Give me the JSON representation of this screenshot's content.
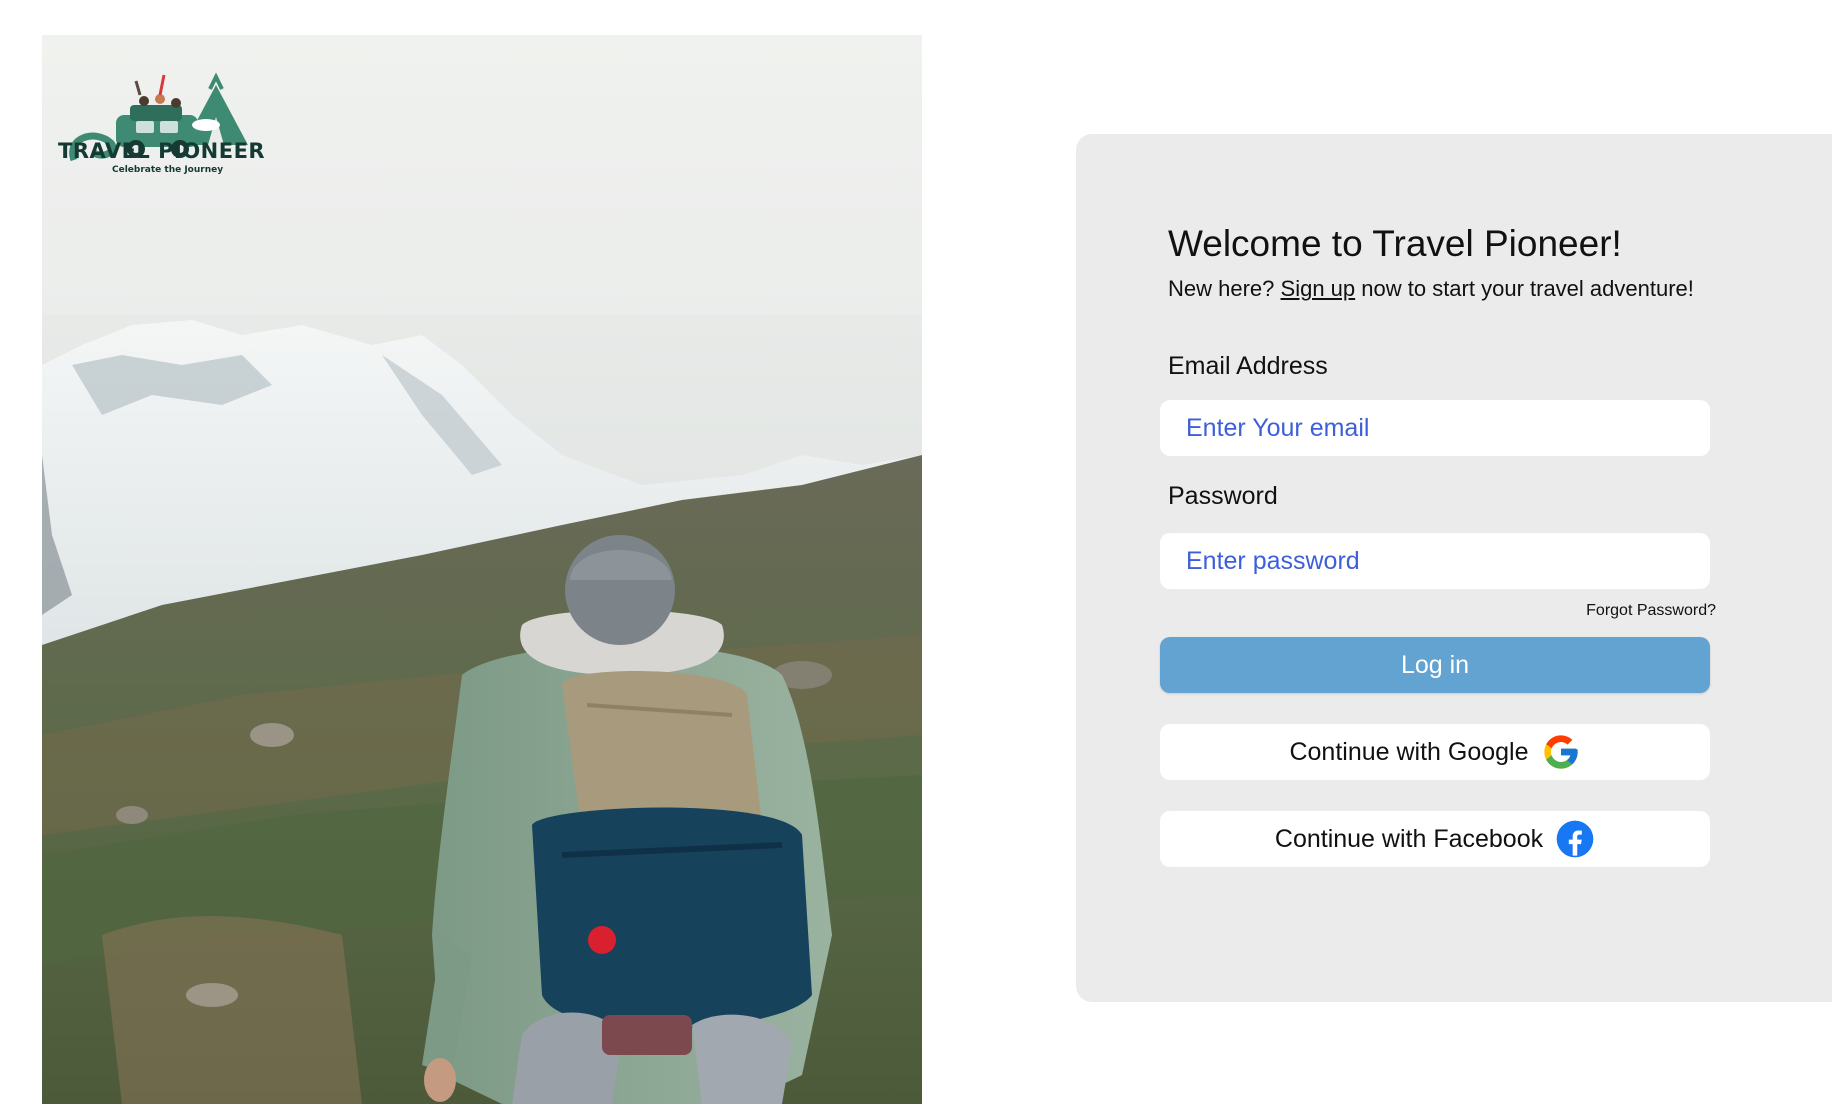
{
  "brand": {
    "name": "TRAVEL PIONEER",
    "tagline": "Celebrate the Journey"
  },
  "login": {
    "welcome": "Welcome to Travel Pioneer!",
    "new_here": "New here?",
    "signup_link": "Sign up",
    "signup_suffix": "now to start your travel adventure!",
    "email_label": "Email Address",
    "email_placeholder": "Enter Your email",
    "password_label": "Password",
    "password_placeholder": "Enter password",
    "forgot_password": "Forgot Password?",
    "login_button": "Log in",
    "google_button": "Continue with Google",
    "facebook_button": "Continue with Facebook"
  },
  "icons": {
    "google": "google-logo-icon",
    "facebook": "facebook-logo-icon"
  },
  "colors": {
    "card_background": "#ebebeb",
    "login_button": "#63a3d1",
    "placeholder": "#3d5fd9",
    "facebook_blue": "#1877f2",
    "logo_green": "#3f8a72"
  }
}
